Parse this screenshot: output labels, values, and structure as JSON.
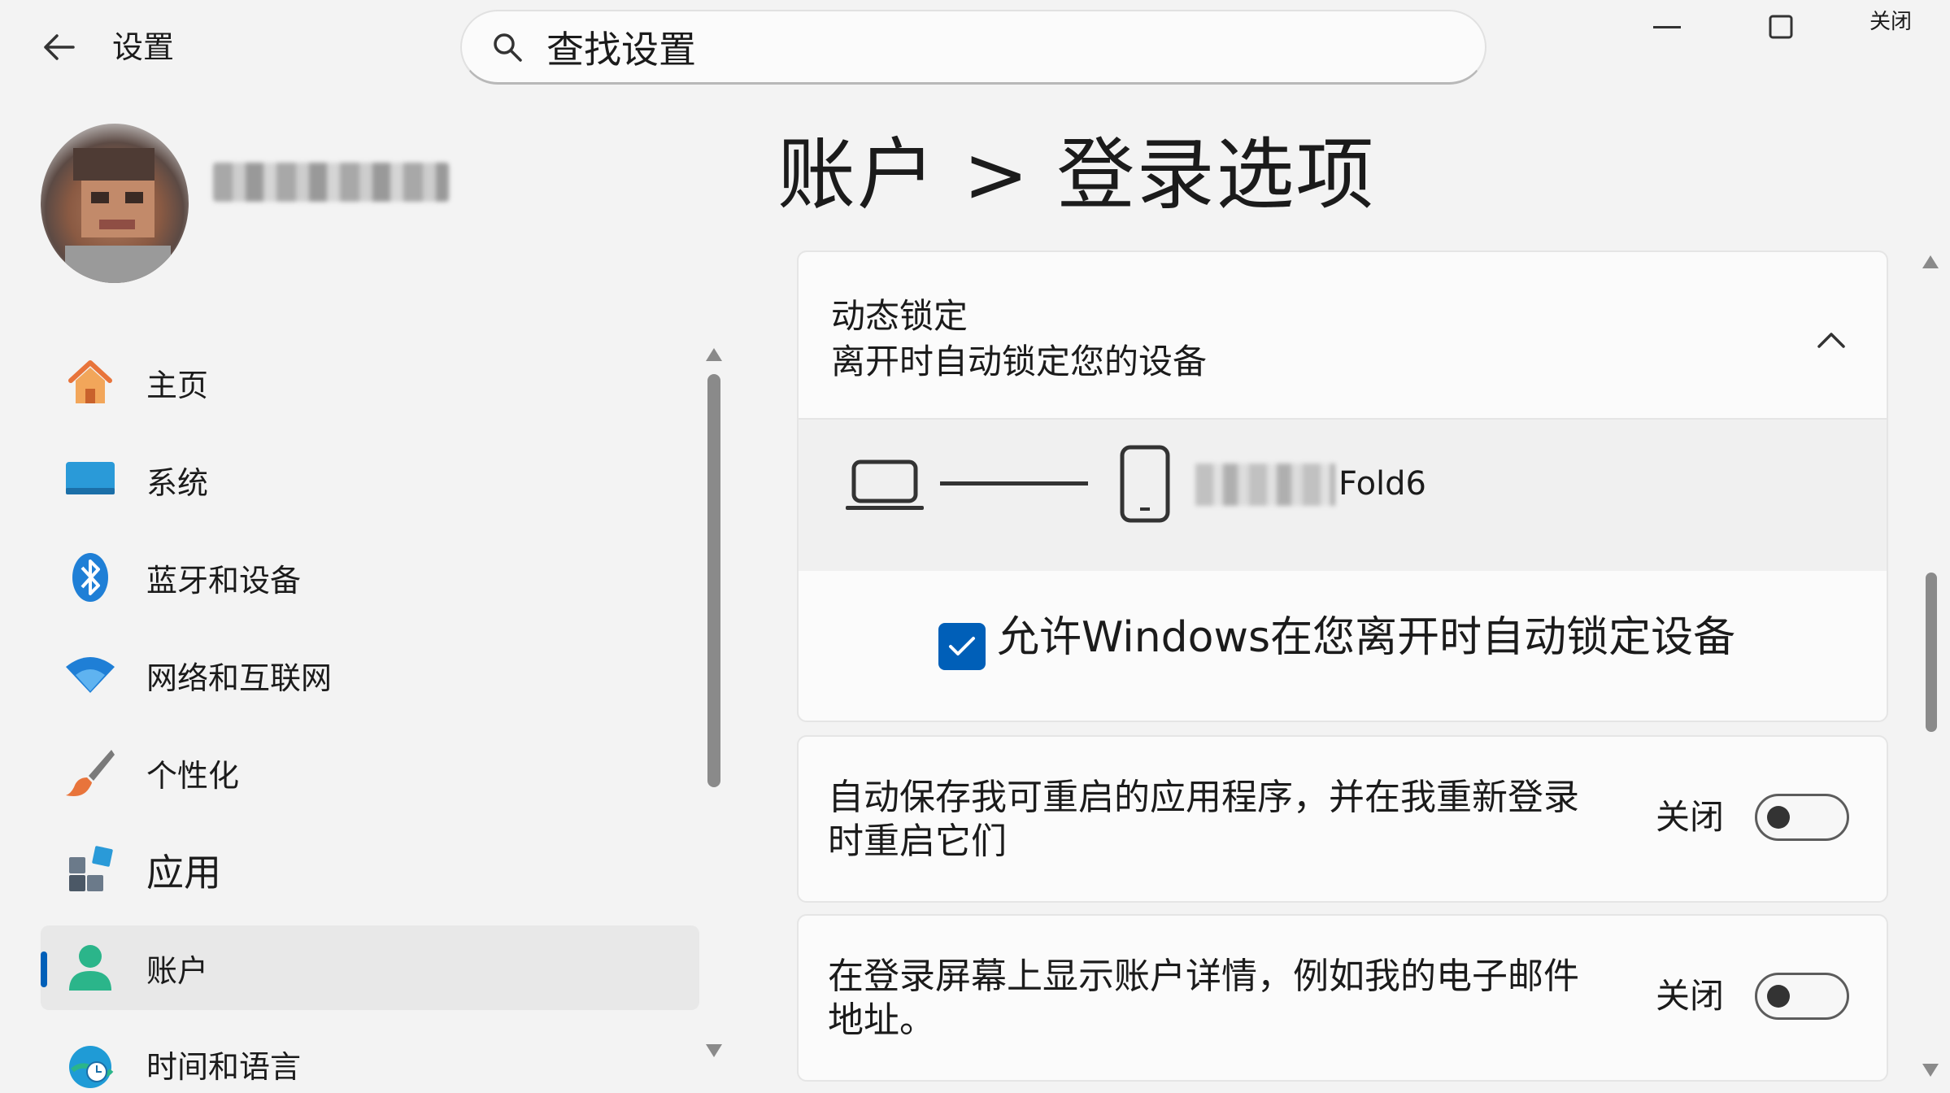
{
  "window": {
    "app_title": "设置",
    "close_label": "关闭"
  },
  "search": {
    "text": "查找设置"
  },
  "sidebar": {
    "items": [
      {
        "label": "主页",
        "icon": "home-icon"
      },
      {
        "label": "系统",
        "icon": "system-icon"
      },
      {
        "label": "蓝牙和设备",
        "icon": "bluetooth-icon"
      },
      {
        "label": "网络和互联网",
        "icon": "wifi-icon"
      },
      {
        "label": "个性化",
        "icon": "brush-icon"
      },
      {
        "label": "应用",
        "icon": "apps-icon"
      },
      {
        "label": "账户",
        "icon": "account-icon",
        "active": true
      },
      {
        "label": "时间和语言",
        "icon": "globe-clock-icon"
      }
    ]
  },
  "main": {
    "page_title": "账户 > 登录选项",
    "dynamic_lock": {
      "title": "动态锁定",
      "description": "离开时自动锁定您的设备",
      "device_name": "Fold6",
      "checkbox_label": "允许Windows在您离开时自动锁定设备",
      "checkbox_checked": true
    },
    "settings": [
      {
        "text": "自动保存我可重启的应用程序，并在我重新登录时重启它们",
        "line1": "自动保存我可重启的应用程序，并在我重新登录",
        "line2": "时重启它们",
        "state": "关闭",
        "on": false
      },
      {
        "text": "在登录屏幕上显示账户详情，例如我的电子邮件地址。",
        "line1": "在登录屏幕上显示账户详情，例如我的电子邮件",
        "line2": "地址。",
        "state": "关闭",
        "on": false
      }
    ]
  },
  "colors": {
    "accent": "#005fb8",
    "background": "#f3f3f3",
    "card": "#fbfbfb"
  }
}
